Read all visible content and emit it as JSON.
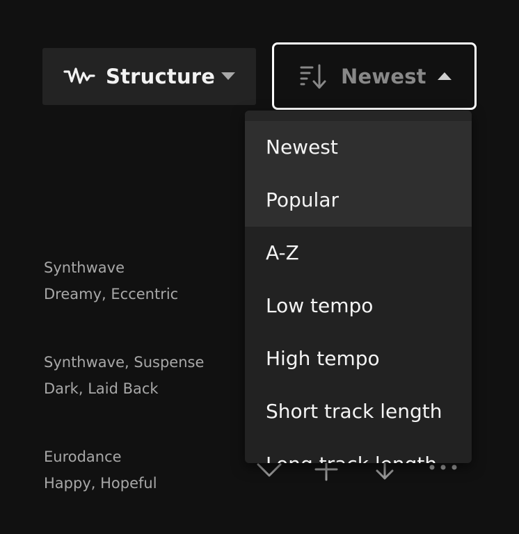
{
  "filters": {
    "structure": {
      "label": "Structure",
      "icon": "waveform-icon"
    },
    "sort": {
      "label": "Newest",
      "icon": "sort-descending-icon",
      "expanded": true
    }
  },
  "sort_menu": {
    "options": [
      {
        "label": "Newest"
      },
      {
        "label": "Popular"
      },
      {
        "label": "A-Z"
      },
      {
        "label": "Low tempo"
      },
      {
        "label": "High tempo"
      },
      {
        "label": "Short track length"
      },
      {
        "label": "Long track length"
      }
    ]
  },
  "tracks": [
    {
      "genres": [
        "Synthwave"
      ],
      "moods": [
        "Dreamy",
        "Eccentric"
      ]
    },
    {
      "genres": [
        "Synthwave",
        "Suspense"
      ],
      "moods": [
        "Dark",
        "Laid Back"
      ]
    },
    {
      "genres": [
        "Eurodance"
      ],
      "moods": [
        "Happy",
        "Hopeful"
      ]
    }
  ],
  "track_actions": [
    "chevron-down-icon",
    "plus-icon",
    "download-icon",
    "more-icon"
  ],
  "colors": {
    "background": "#111111",
    "button_bg": "#232323",
    "menu_bg": "#222222",
    "menu_highlight": "#2f2f2f",
    "active_border": "#ffffff",
    "muted_text": "#a8a8a8"
  }
}
